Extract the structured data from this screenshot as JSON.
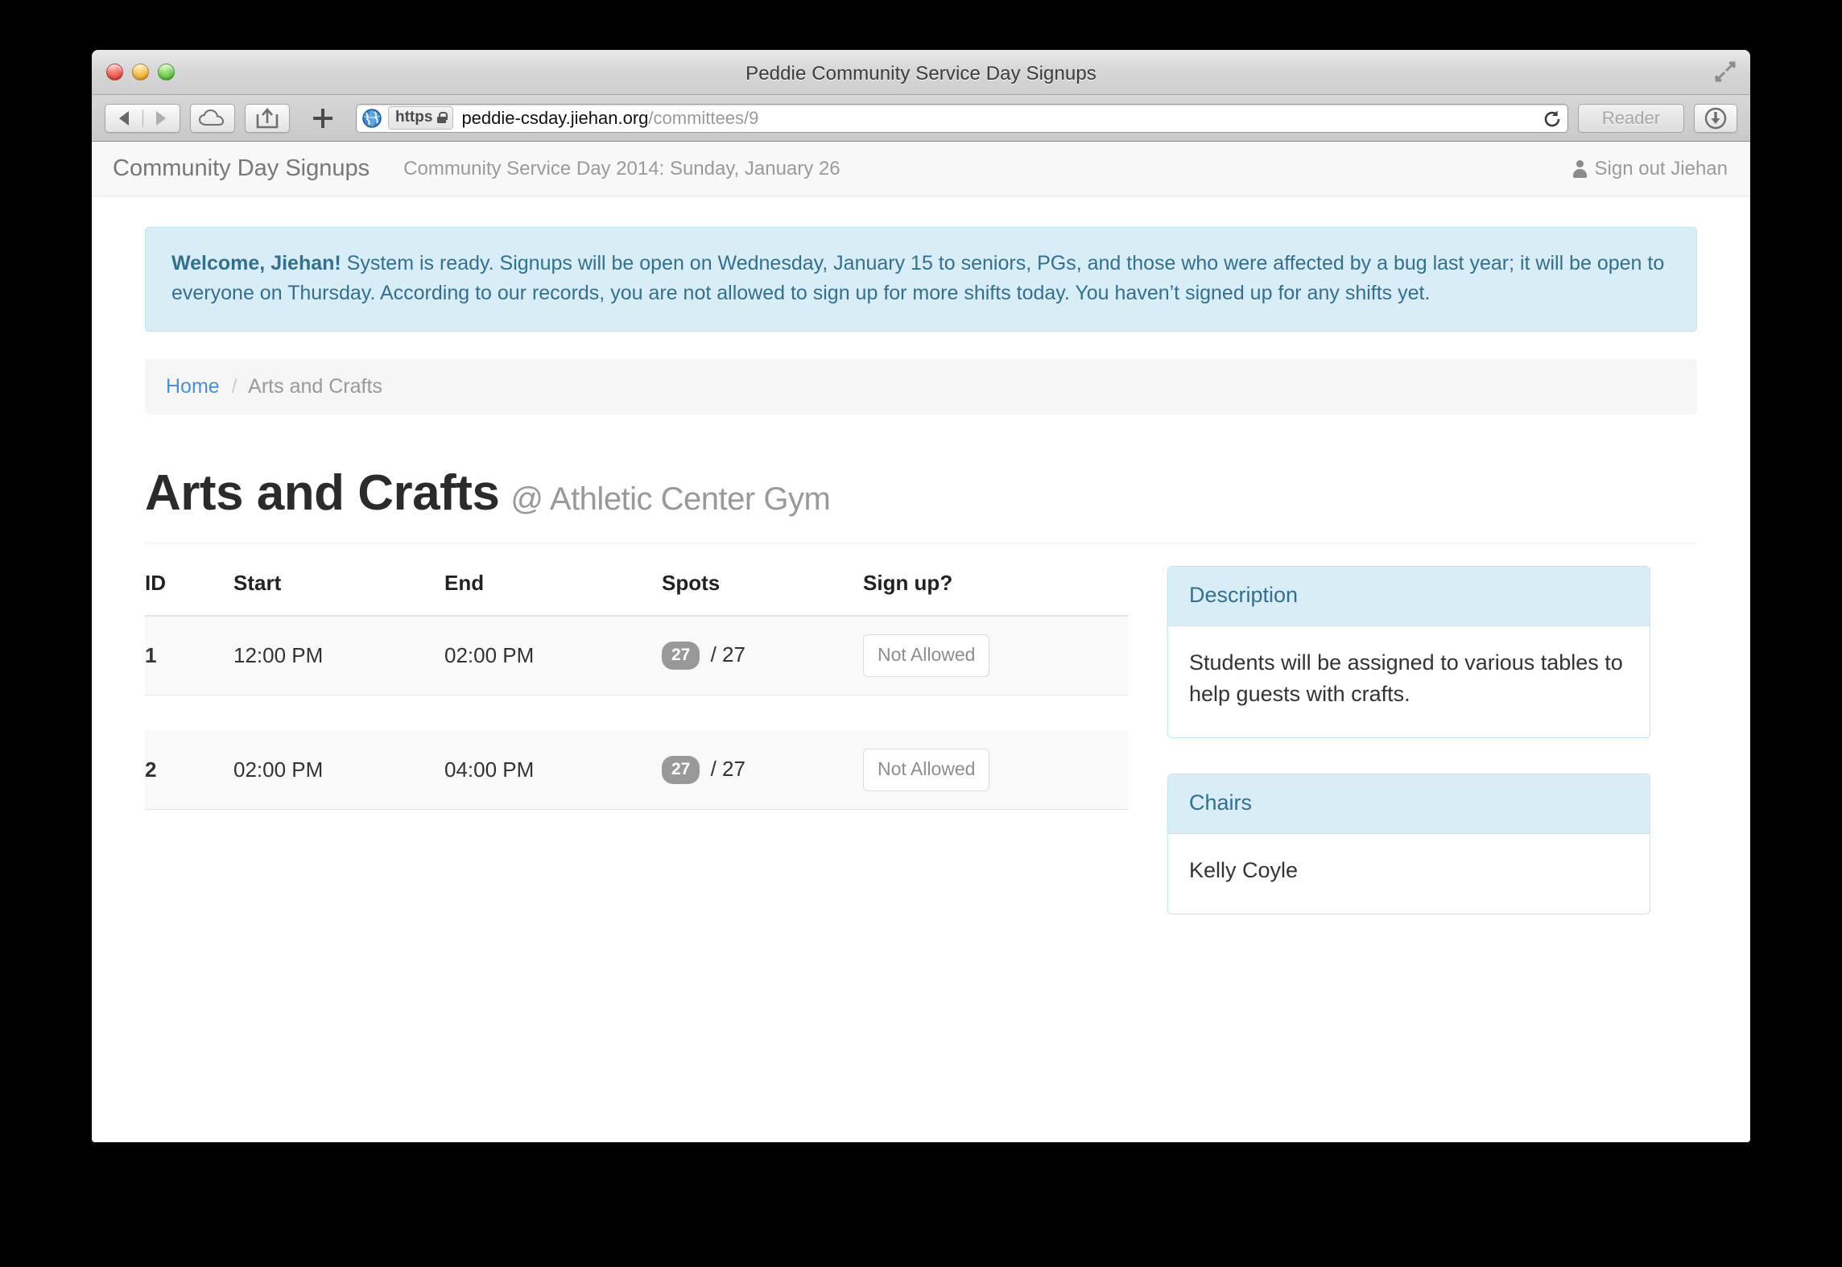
{
  "window": {
    "title": "Peddie Community Service Day Signups",
    "traffic_lights": [
      "close",
      "minimize",
      "zoom"
    ]
  },
  "toolbar": {
    "back_label": "Back",
    "forward_label": "Forward",
    "icloud_label": "iCloud Tabs",
    "share_label": "Share",
    "newtab_label": "New Tab",
    "scheme_label": "https",
    "url_host": "peddie-csday.jiehan.org",
    "url_path": "/committees/9",
    "reload_label": "Reload",
    "reader_label": "Reader",
    "downloads_label": "Downloads"
  },
  "navbar": {
    "brand": "Community Day Signups",
    "event": "Community Service Day 2014: Sunday, January 26",
    "signout": "Sign out Jiehan"
  },
  "alert": {
    "greeting": "Welcome, Jiehan!",
    "message": "System is ready.  Signups will be open on Wednesday, January 15 to seniors, PGs, and those who were affected by a bug last year; it will be open to everyone on Thursday.  According to our records, you are not allowed to sign up for more shifts today.  You haven’t signed up for any shifts yet."
  },
  "breadcrumb": {
    "home": "Home",
    "separator": "/",
    "current": "Arts and Crafts"
  },
  "header": {
    "title": "Arts and Crafts",
    "subtitle": "@ Athletic Center Gym"
  },
  "table": {
    "columns": [
      "ID",
      "Start",
      "End",
      "Spots",
      "Sign up?"
    ],
    "rows": [
      {
        "id": "1",
        "start": "12:00 PM",
        "end": "02:00 PM",
        "spots_open": "27",
        "spots_total": "/ 27",
        "action": "Not Allowed"
      },
      {
        "id": "2",
        "start": "02:00 PM",
        "end": "04:00 PM",
        "spots_open": "27",
        "spots_total": "/ 27",
        "action": "Not Allowed"
      }
    ]
  },
  "panels": {
    "description": {
      "heading": "Description",
      "body": "Students will be assigned to various tables to help guests with crafts."
    },
    "chairs": {
      "heading": "Chairs",
      "body": "Kelly Coyle"
    }
  },
  "colors": {
    "info_bg": "#d9edf7",
    "info_border": "#bce8f1",
    "info_text": "#31708f",
    "link": "#4a90d9",
    "badge_bg": "#999999",
    "muted": "#999999"
  }
}
